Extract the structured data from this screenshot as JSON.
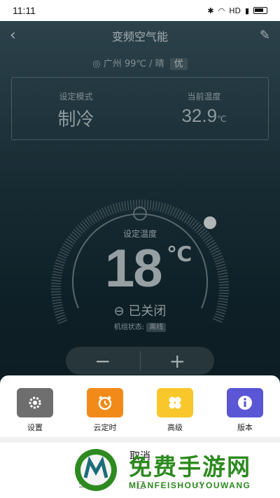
{
  "status_bar": {
    "time": "11:11",
    "network": "HD"
  },
  "header": {
    "title": "变频空气能"
  },
  "location": {
    "text": "广州 99℃ / 晴",
    "air_quality": "优"
  },
  "mode": {
    "set_mode_label": "设定模式",
    "set_mode_value": "制冷",
    "current_temp_label": "当前温度",
    "current_temp_value": "32.9",
    "current_temp_unit": "℃"
  },
  "dial": {
    "label": "设定温度",
    "value": "18",
    "unit": "℃"
  },
  "power": {
    "state": "已关闭",
    "unit_state_label": "机组状态:",
    "unit_state_value": "离线"
  },
  "stepper": {
    "minus": "−",
    "plus": "+"
  },
  "sheet": {
    "options": [
      {
        "label": "设置",
        "color": "#6e6e6e",
        "icon": "gear-icon"
      },
      {
        "label": "云定时",
        "color": "#f28a1a",
        "icon": "alarm-clock-icon"
      },
      {
        "label": "高级",
        "color": "#f7c72b",
        "icon": "grid-icon"
      },
      {
        "label": "版本",
        "color": "#5a56d6",
        "icon": "info-icon"
      }
    ],
    "cancel": "取消"
  },
  "watermark": {
    "text": "免费手游网",
    "sub": "MIANFEISHOUYOUWANG"
  },
  "colors": {
    "accent_green": "#2c8a1e"
  }
}
